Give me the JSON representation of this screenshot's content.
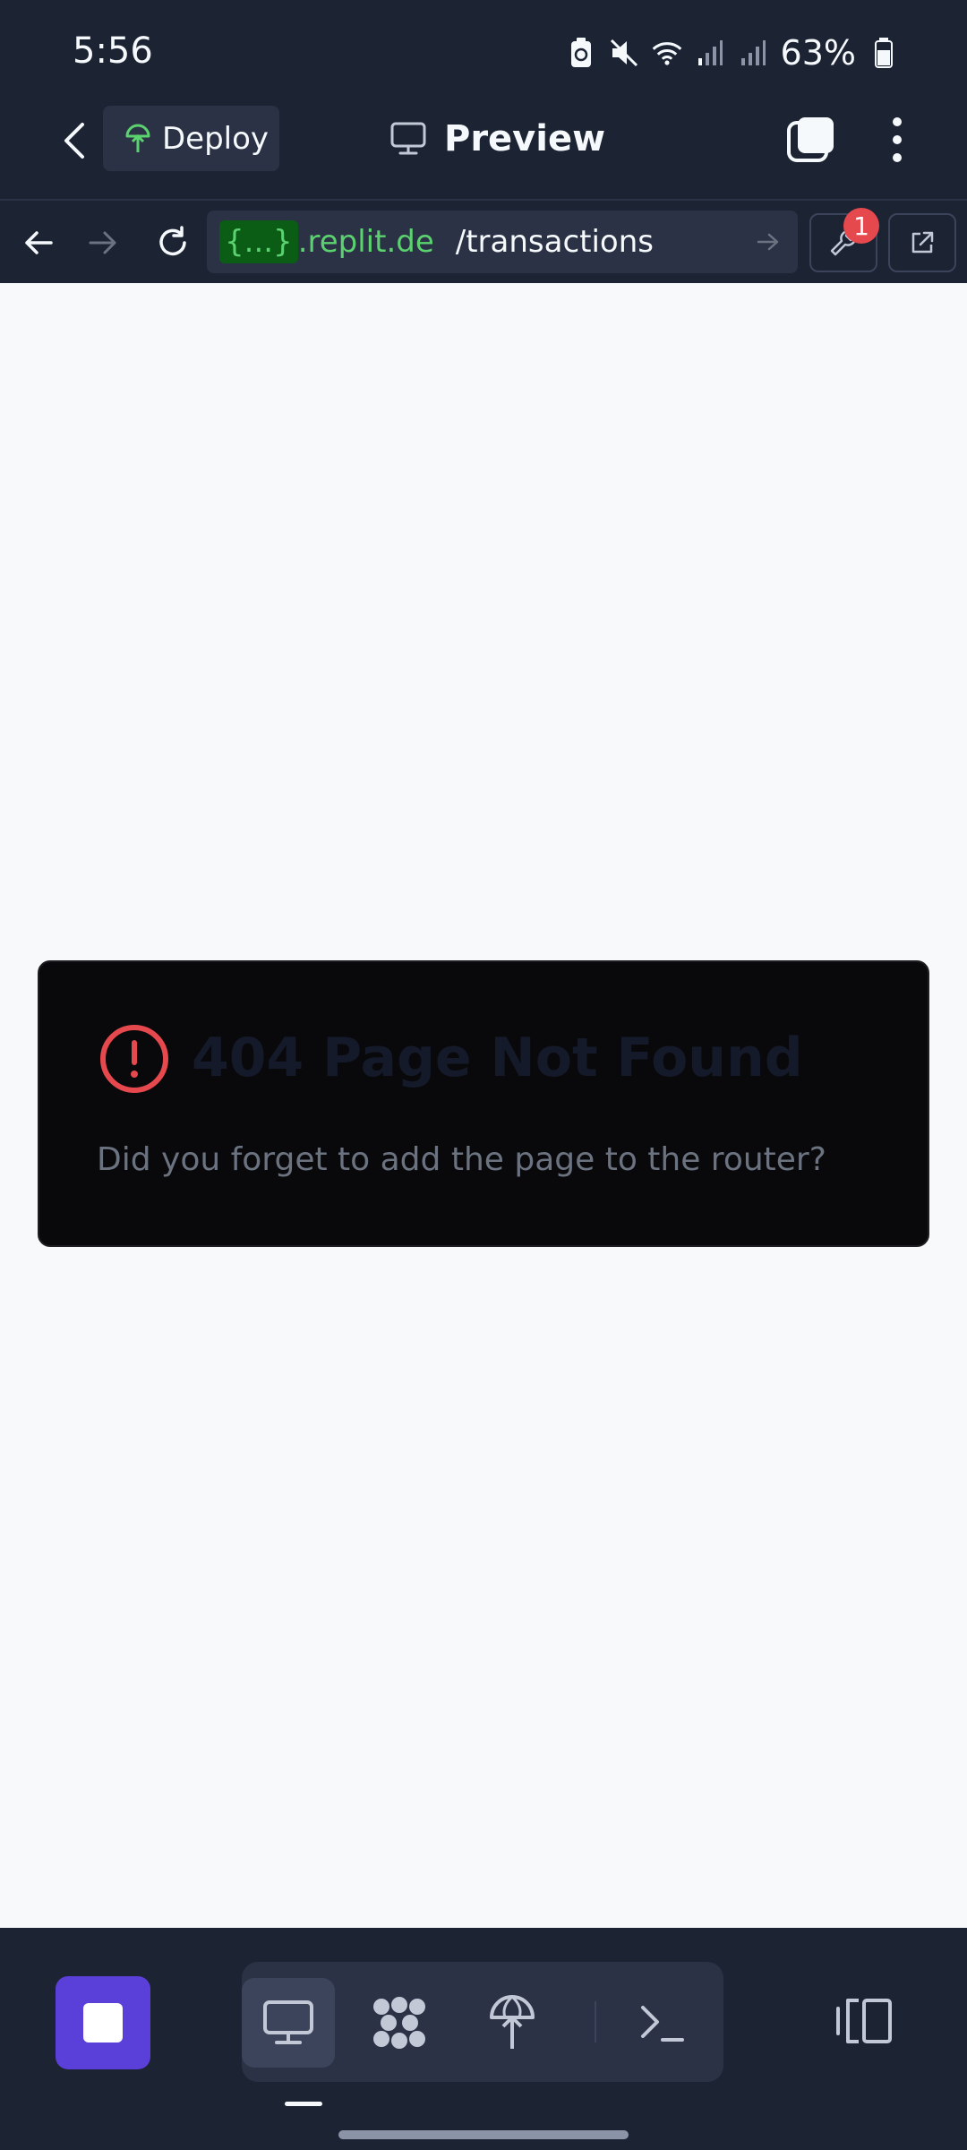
{
  "status_bar": {
    "time": "5:56",
    "battery_percent": "63%",
    "icons": [
      "battery-saver-icon",
      "mute-icon",
      "wifi-icon",
      "signal-icon",
      "signal-icon",
      "battery-icon"
    ]
  },
  "header": {
    "deploy_label": "Deploy",
    "title": "Preview"
  },
  "url_bar": {
    "host_token": "{...}",
    "host": ".replit.de",
    "path": "/transactions",
    "devtools_badge": "1"
  },
  "page": {
    "error_title": "404 Page Not Found",
    "error_message": "Did you forget to add the page to the router?"
  },
  "colors": {
    "chrome_bg": "#1c2333",
    "webview_bg": "#f8f9fb",
    "card_bg": "#09090b",
    "error_red": "#e5484d",
    "accent_purple": "#5a3fd8",
    "url_green": "#5bd16f"
  },
  "bottom_toolbar": {
    "tools": [
      "preview-monitor-icon",
      "agent-icon",
      "deploy-icon",
      "shell-icon"
    ],
    "active_tool": "preview-monitor-icon"
  }
}
